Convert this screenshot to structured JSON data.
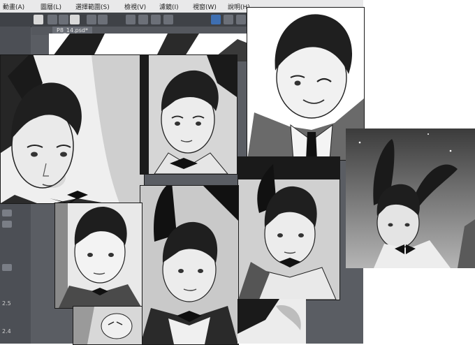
{
  "app": {
    "menu": [
      "動畫(A)",
      "圖層(L)",
      "選擇範圍(S)",
      "檢視(V)",
      "濾鏡(I)",
      "視窗(W)",
      "說明(H)"
    ],
    "document_tab": "P8_14.psd*",
    "side_numbers": [
      "2.5",
      "2.4"
    ]
  },
  "colors": {
    "ui_dark": "#3f4247",
    "ui_panel": "#4c4f55",
    "menubar": "#e9e9ea",
    "accent_blue": "#3e6fb2"
  }
}
